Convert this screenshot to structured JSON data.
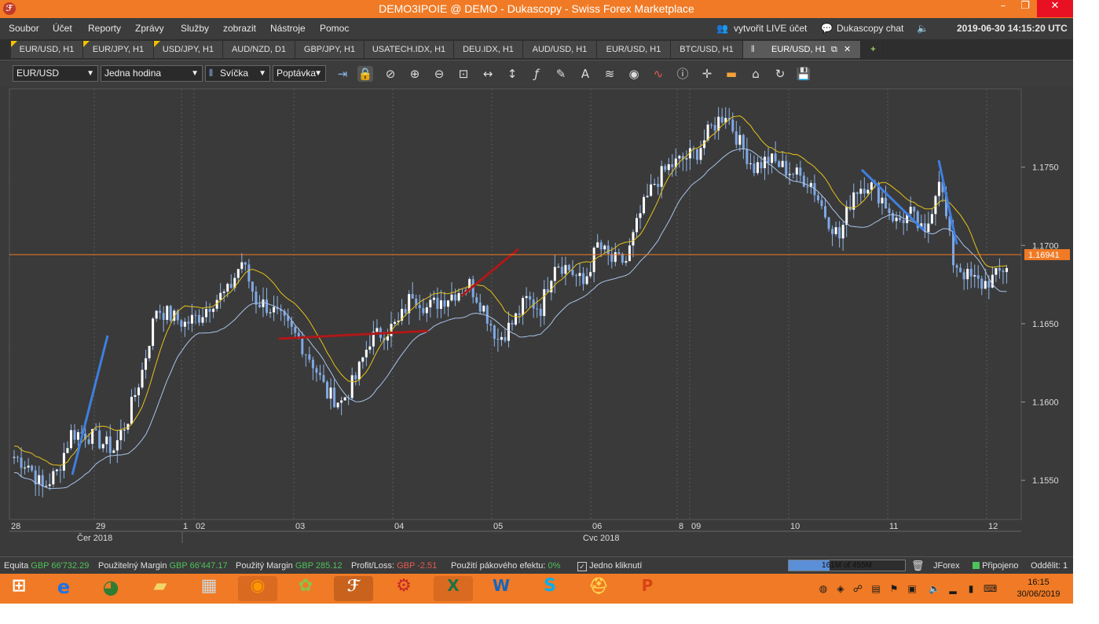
{
  "window": {
    "title": "DEMO3IPOIE @ DEMO - Dukascopy - Swiss Forex Marketplace",
    "app_icon": "jforex-icon"
  },
  "menu": {
    "items": [
      "Soubor",
      "Účet",
      "Reporty",
      "Zprávy",
      "Služby",
      "zobrazit",
      "Nástroje",
      "Pomoc"
    ],
    "live_account": "vytvořit LIVE účet",
    "chat": "Dukascopy chat",
    "datetime": "2019-06-30 14:15:20 UTC"
  },
  "tabs": [
    {
      "label": "EUR/USD, H1",
      "flag": true
    },
    {
      "label": "EUR/JPY, H1",
      "flag": true
    },
    {
      "label": "USD/JPY, H1",
      "flag": true
    },
    {
      "label": "AUD/NZD, D1",
      "flag": false
    },
    {
      "label": "GBP/JPY, H1",
      "flag": false
    },
    {
      "label": "USATECH.IDX, H1",
      "flag": false
    },
    {
      "label": "DEU.IDX, H1",
      "flag": false
    },
    {
      "label": "AUD/USD, H1",
      "flag": false
    },
    {
      "label": "EUR/USD, H1",
      "flag": false
    },
    {
      "label": "BTC/USD, H1",
      "flag": false
    },
    {
      "label": "EUR/USD, H1",
      "flag": false,
      "active": true
    }
  ],
  "toolbar": {
    "instrument": "EUR/USD",
    "period": "Jedna hodina",
    "chart_type": "Svíčka",
    "side": "Poptávka"
  },
  "chart_data": {
    "type": "candlestick",
    "instrument": "EUR/USD",
    "period": "H1",
    "ylim": [
      1.1525,
      1.18
    ],
    "y_ticks": [
      "1.1750",
      "1.1700",
      "1.1650",
      "1.1600",
      "1.1550"
    ],
    "current_price": "1.16941",
    "x_day_labels": [
      "28",
      "29",
      "1",
      "02",
      "03",
      "04",
      "05",
      "06",
      "8",
      "09",
      "10",
      "11",
      "12"
    ],
    "x_month_labels": [
      "Čer 2018",
      "Cvc 2018"
    ],
    "close_path": [
      1.1565,
      1.156,
      1.1545,
      1.1555,
      1.158,
      1.158,
      1.1575,
      1.157,
      1.159,
      1.162,
      1.166,
      1.1655,
      1.165,
      1.1655,
      1.1665,
      1.167,
      1.169,
      1.1665,
      1.166,
      1.165,
      1.164,
      1.1625,
      1.1605,
      1.16,
      1.1615,
      1.164,
      1.1645,
      1.165,
      1.167,
      1.166,
      1.1665,
      1.167,
      1.1675,
      1.166,
      1.164,
      1.165,
      1.1665,
      1.166,
      1.169,
      1.1685,
      1.1675,
      1.17,
      1.169,
      1.169,
      1.172,
      1.174,
      1.175,
      1.1755,
      1.176,
      1.1775,
      1.1785,
      1.1765,
      1.175,
      1.1755,
      1.175,
      1.1745,
      1.174,
      1.172,
      1.1705,
      1.1735,
      1.174,
      1.173,
      1.1715,
      1.172,
      1.1705,
      1.1745,
      1.169,
      1.168,
      1.1675,
      1.168,
      1.169
    ]
  },
  "status": {
    "equity_label": "Equita",
    "equity_value": "GBP 66'732.29",
    "margin_label": "Použitelný Margin",
    "margin_value": "GBP 66'447.17",
    "used_label": "Použitý Margin",
    "used_value": "GBP 285.12",
    "pl_label": "Profit/Loss:",
    "pl_value": "GBP -2.51",
    "lev_label": "Použití pákového efektu:",
    "lev_value": "0%",
    "one_click": "Jedno kliknutí",
    "memory": "161M of 455M",
    "memory_fraction": 0.354,
    "jforex": "JForex",
    "connected": "Připojeno",
    "divide": "Oddělit: 1"
  },
  "taskbar": {
    "time": "16:15",
    "date": "30/06/2019"
  }
}
